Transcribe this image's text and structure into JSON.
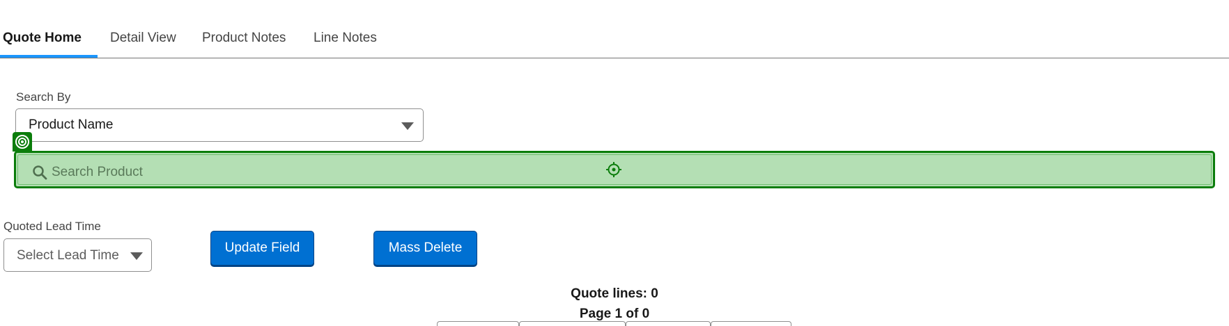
{
  "tabs": [
    {
      "label": "Quote Home",
      "active": true
    },
    {
      "label": "Detail View",
      "active": false
    },
    {
      "label": "Product Notes",
      "active": false
    },
    {
      "label": "Line Notes",
      "active": false
    }
  ],
  "search_by": {
    "label": "Search By",
    "selected": "Product Name"
  },
  "search": {
    "placeholder": "Search Product"
  },
  "lead_time": {
    "label": "Quoted Lead Time",
    "placeholder": "Select Lead Time"
  },
  "buttons": {
    "update_field": "Update Field",
    "mass_delete": "Mass Delete"
  },
  "summary": {
    "quote_lines": "Quote lines: 0",
    "page": "Page 1 of 0"
  },
  "colors": {
    "brand_button": "#0070d2",
    "active_tab_underline": "#1b96ff",
    "highlight_border": "#0b7d0b",
    "highlight_fill": "#b4dfb4"
  },
  "icons": {
    "search": "search-icon",
    "target_badge": "target-icon",
    "crosshair": "crosshair-icon",
    "dropdown": "chevron-down-icon"
  }
}
